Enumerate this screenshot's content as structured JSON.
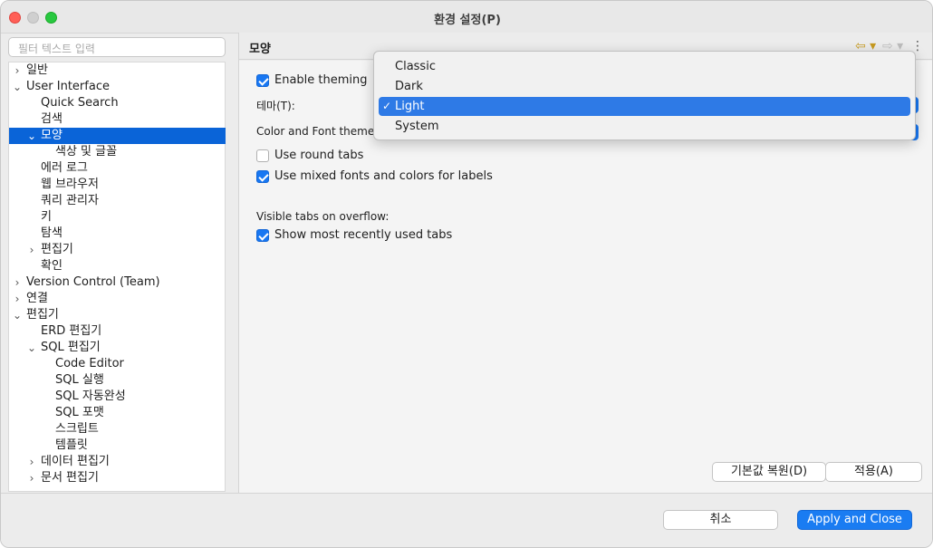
{
  "window": {
    "title": "환경 설정(P)"
  },
  "filter": {
    "placeholder": "필터 텍스트 입력"
  },
  "tree": {
    "items": [
      {
        "label": "일반",
        "chevron": "›"
      },
      {
        "label": "User Interface",
        "chevron": "⌄"
      },
      {
        "label": "Quick Search",
        "chevron": ""
      },
      {
        "label": "검색",
        "chevron": ""
      },
      {
        "label": "모양",
        "chevron": "⌄"
      },
      {
        "label": "색상 및 글꼴",
        "chevron": ""
      },
      {
        "label": "에러 로그",
        "chevron": ""
      },
      {
        "label": "웹 브라우저",
        "chevron": ""
      },
      {
        "label": "쿼리 관리자",
        "chevron": ""
      },
      {
        "label": "키",
        "chevron": ""
      },
      {
        "label": "탐색",
        "chevron": ""
      },
      {
        "label": "편집기",
        "chevron": "›"
      },
      {
        "label": "확인",
        "chevron": ""
      },
      {
        "label": "Version Control (Team)",
        "chevron": "›"
      },
      {
        "label": "연결",
        "chevron": "›"
      },
      {
        "label": "편집기",
        "chevron": "⌄"
      },
      {
        "label": "ERD 편집기",
        "chevron": ""
      },
      {
        "label": "SQL 편집기",
        "chevron": "⌄"
      },
      {
        "label": "Code Editor",
        "chevron": ""
      },
      {
        "label": "SQL 실행",
        "chevron": ""
      },
      {
        "label": "SQL 자동완성",
        "chevron": ""
      },
      {
        "label": "SQL 포맷",
        "chevron": ""
      },
      {
        "label": "스크립트",
        "chevron": ""
      },
      {
        "label": "템플릿",
        "chevron": ""
      },
      {
        "label": "데이터 편집기",
        "chevron": "›"
      },
      {
        "label": "문서 편집기",
        "chevron": "›"
      }
    ]
  },
  "page": {
    "title": "모양",
    "enable_theming": "Enable theming",
    "theme_label": "테마(T):",
    "color_font_theme_label": "Color and Font theme:",
    "use_round_tabs": "Use round tabs",
    "use_mixed_fonts": "Use mixed fonts and colors for labels",
    "visible_tabs_label": "Visible tabs on overflow:",
    "show_mru_tabs": "Show most recently used tabs",
    "restore_defaults": "기본값 복원(D)",
    "apply": "적용(A)"
  },
  "nav": {
    "back_icon": "⇦ ▾",
    "forward_icon": "⇨ ▾",
    "menu_icon": "⋮"
  },
  "dropdown": {
    "options": [
      "Classic",
      "Dark",
      "Light",
      "System"
    ],
    "selected": "Light",
    "check": "✓"
  },
  "footer": {
    "cancel": "취소",
    "apply_close": "Apply and Close"
  },
  "colors": {
    "accent": "#1a7cf2",
    "selection": "#0a64d8"
  }
}
